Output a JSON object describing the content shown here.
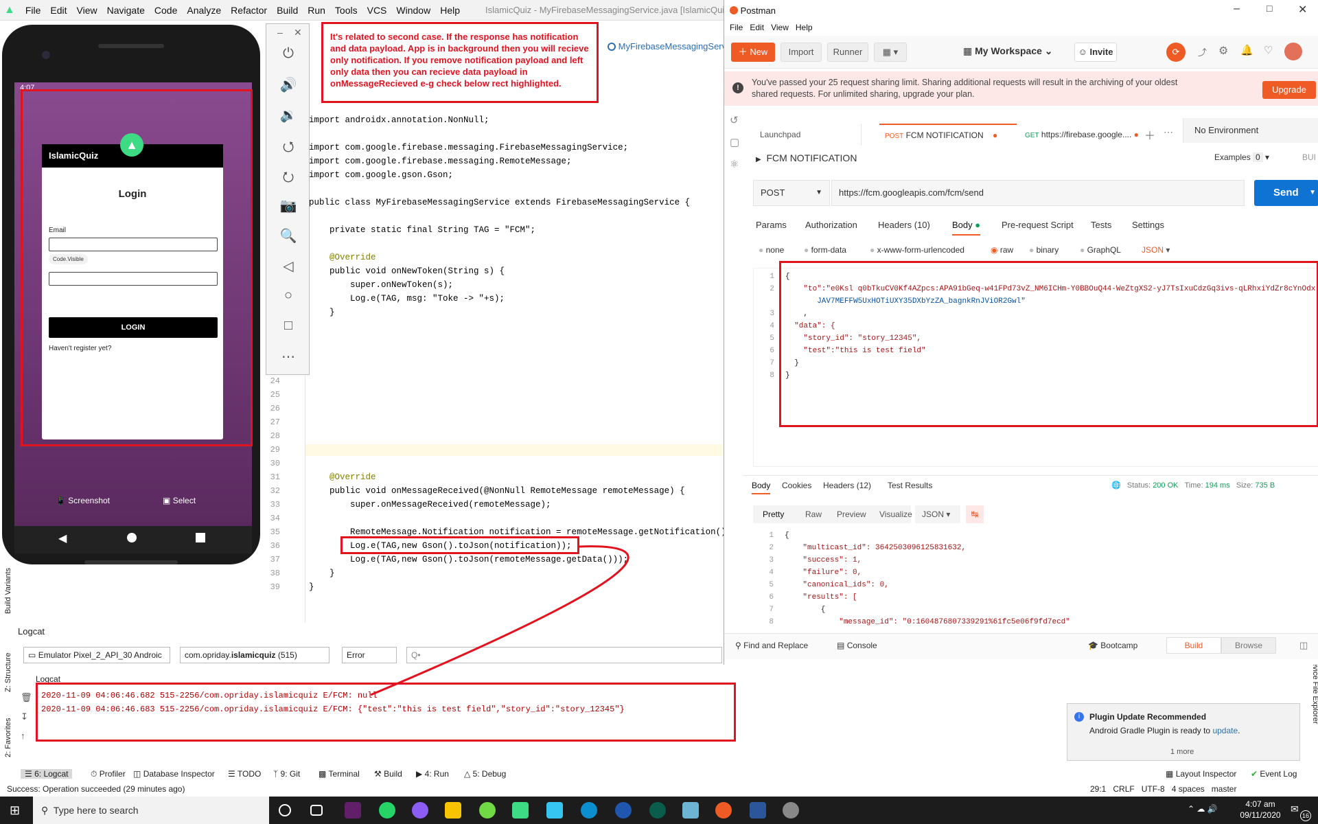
{
  "as": {
    "menu": [
      "File",
      "Edit",
      "View",
      "Navigate",
      "Code",
      "Analyze",
      "Refactor",
      "Build",
      "Run",
      "Tools",
      "VCS",
      "Window",
      "Help"
    ],
    "title": "IslamicQuiz - MyFirebaseMessagingService.java [IslamicQuiz.app] - Android Studio",
    "file_tab": "MyFirebaseMessagingServi",
    "callout": "It's related to second case. If the response has notification and data payload. App is in background then you will recieve only notification. If you remove notification payload and left only data then you can recieve data payload in onMessageRecieved e-g check below rect highlighted.",
    "code_top": [
      {
        "t": "import androidx.annotation.NonNull;"
      },
      {
        "t": "import com.google.firebase.messaging.FirebaseMessagingService;"
      },
      {
        "t": "import com.google.firebase.messaging.RemoteMessage;"
      },
      {
        "t": "import com.google.gson.Gson;"
      },
      {
        "t": "public class MyFirebaseMessagingService extends FirebaseMessagingService {"
      },
      {
        "t": "    private static final String TAG = \"FCM\";"
      },
      {
        "t": "    @Override"
      },
      {
        "t": "    public void onNewToken(String s) {"
      },
      {
        "t": "        super.onNewToken(s);"
      },
      {
        "t": "        Log.e(TAG, msg: \"Toke -> \"+s);"
      },
      {
        "t": "    }"
      }
    ],
    "line_numbers": [
      "24",
      "25",
      "26",
      "27",
      "28",
      "29",
      "30",
      "31",
      "32",
      "33",
      "34",
      "35",
      "36",
      "37",
      "38",
      "39"
    ],
    "code_bottom": [
      {
        "t": "    @Override"
      },
      {
        "t": "    public void onMessageReceived(@NonNull RemoteMessage remoteMessage) {"
      },
      {
        "t": "        super.onMessageReceived(remoteMessage);"
      },
      {
        "t": "        RemoteMessage.Notification notification = remoteMessage.getNotification();"
      },
      {
        "t": "        Log.e(TAG,new Gson().toJson(notification));"
      },
      {
        "t": "        Log.e(TAG,new Gson().toJson(remoteMessage.getData()));"
      },
      {
        "t": "    }"
      },
      {
        "t": "}"
      }
    ],
    "logcat_label": "Logcat",
    "logcat_inner": "Logcat",
    "device": "Emulator Pixel_2_API_30 Androic",
    "process": "com.opriday.",
    "process_bold": "islamicquiz",
    "process_pid": " (515)",
    "level": "Error",
    "search_placeholder": "Q•",
    "log_lines": [
      "2020-11-09 04:06:46.682 515-2256/com.opriday.islamicquiz E/FCM: null",
      "2020-11-09 04:06:46.683 515-2256/com.opriday.islamicquiz E/FCM: {\"test\":\"this is test field\",\"story_id\":\"story_12345\"}"
    ],
    "bottom_tabs": [
      "6: Logcat",
      "Profiler",
      "Database Inspector",
      "TODO",
      "9: Git",
      "Terminal",
      "Build",
      "4: Run",
      "5: Debug"
    ],
    "layout_inspector": "Layout Inspector",
    "event_log": "Event Log",
    "status_left": "Success: Operation succeeded (29 minutes ago)",
    "status_right": [
      "29:1",
      "CRLF",
      "UTF-8",
      "4 spaces",
      "master"
    ],
    "plugin_title": "Plugin Update Recommended",
    "plugin_body_prefix": "Android Gradle Plugin is ready to ",
    "plugin_link": "update",
    "plugin_more": "1 more",
    "side_left": [
      "Build Variants",
      "Z: Structure",
      "2: Favorites"
    ],
    "side_right": "Device File Explorer"
  },
  "phone": {
    "status_time": "4:07",
    "app_name": "IslamicQuiz",
    "heading": "Login",
    "email_label": "Email",
    "tooltip": "Code.Visible",
    "login_button": "LOGIN",
    "register_text": "Haven't register yet?",
    "screenshot_label": "Screenshot",
    "select_label": "Select"
  },
  "pm": {
    "title": "Postman",
    "menu": [
      "File",
      "Edit",
      "View",
      "Help"
    ],
    "new": "New",
    "import": "Import",
    "runner": "Runner",
    "workspace": "My Workspace",
    "invite": "Invite",
    "banner": "You've passed your 25 request sharing limit. Sharing additional requests will result in the archiving of your oldest shared requests. For unlimited sharing, upgrade your plan.",
    "upgrade": "Upgrade",
    "tabs": [
      {
        "m": "",
        "n": "Launchpad"
      },
      {
        "m": "POST",
        "n": "FCM NOTIFICATION"
      },
      {
        "m": "GET",
        "n": "https://firebase.google...."
      }
    ],
    "env": "No Environment",
    "request_name": "FCM NOTIFICATION",
    "examples": "Examples",
    "examples_count": "0",
    "build_cut": "BUI",
    "method": "POST",
    "url": "https://fcm.googleapis.com/fcm/send",
    "send": "Send",
    "req_tabs": [
      "Params",
      "Authorization",
      "Headers (10)",
      "Body",
      "Pre-request Script",
      "Tests",
      "Settings"
    ],
    "body_modes": [
      "none",
      "form-data",
      "x-www-form-urlencoded",
      "raw",
      "binary",
      "GraphQL"
    ],
    "body_lang": "JSON",
    "req_lines": [
      {
        "n": "1",
        "t": "{"
      },
      {
        "n": "2",
        "t": "    \"to\":\"e0Ksl q0bTkuCV0Kf4AZpcs:APA91bGeq-w41FPd73vZ_NM6ICHm-Y0BBOuQ44-WeZtgXS2-yJ7TsIxuCdzGq3ivs-qLRhxiYdZr8cYnOdx"
      },
      {
        "n": "",
        "t": "       JAV7MEFFW5UxHOTiUXY35DXbYzZA_bagnkRnJViOR2Gwl\""
      },
      {
        "n": "3",
        "t": "    ,"
      },
      {
        "n": "4",
        "t": "  \"data\": {"
      },
      {
        "n": "5",
        "t": "    \"story_id\": \"story_12345\","
      },
      {
        "n": "6",
        "t": "    \"test\":\"this is test field\""
      },
      {
        "n": "7",
        "t": "  }"
      },
      {
        "n": "8",
        "t": "}"
      }
    ],
    "res_tabs": [
      "Body",
      "Cookies",
      "Headers (12)",
      "Test Results"
    ],
    "status_label": "Status:",
    "status": "200 OK",
    "time_label": "Time:",
    "time": "194 ms",
    "size_label": "Size:",
    "size": "735 B",
    "res_views": [
      "Pretty",
      "Raw",
      "Preview",
      "Visualize"
    ],
    "res_lang": "JSON",
    "res_lines": [
      {
        "n": "1",
        "t": "{"
      },
      {
        "n": "2",
        "t": "    \"multicast_id\": 3642503096125831632,"
      },
      {
        "n": "3",
        "t": "    \"success\": 1,"
      },
      {
        "n": "4",
        "t": "    \"failure\": 0,"
      },
      {
        "n": "5",
        "t": "    \"canonical_ids\": 0,"
      },
      {
        "n": "6",
        "t": "    \"results\": ["
      },
      {
        "n": "7",
        "t": "        {"
      },
      {
        "n": "8",
        "t": "            \"message_id\": \"0:1604876807339291%61fc5e06f9fd7ecd\""
      }
    ],
    "find_replace": "Find and Replace",
    "console": "Console",
    "bootcamp": "Bootcamp",
    "build": "Build",
    "browse": "Browse"
  },
  "taskbar": {
    "search": "Type here to search",
    "time": "4:07 am",
    "date": "09/11/2020",
    "notif_count": "16"
  },
  "colors": {
    "red_annotation": "#e0131f",
    "postman_orange": "#ef5b25",
    "send_blue": "#0f73d4"
  }
}
